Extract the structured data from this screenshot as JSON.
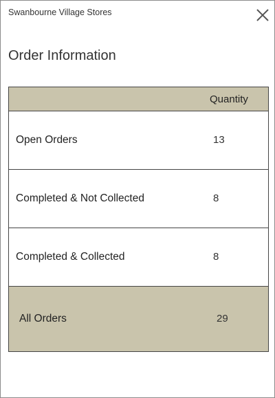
{
  "header": {
    "store_name": "Swanbourne Village Stores",
    "close_icon": "close-icon"
  },
  "page_title": "Order Information",
  "table": {
    "columns": [
      "",
      "Quantity"
    ],
    "rows": [
      {
        "label": "Open Orders",
        "quantity": "13"
      },
      {
        "label": "Completed & Not Collected",
        "quantity": "8"
      },
      {
        "label": "Completed & Collected",
        "quantity": "8"
      }
    ],
    "total": {
      "label": "All Orders",
      "quantity": "29"
    }
  },
  "colors": {
    "header_bg": "#c9c4ac",
    "total_bg": "#c9c4ac",
    "border": "#444444",
    "text": "#222222"
  }
}
